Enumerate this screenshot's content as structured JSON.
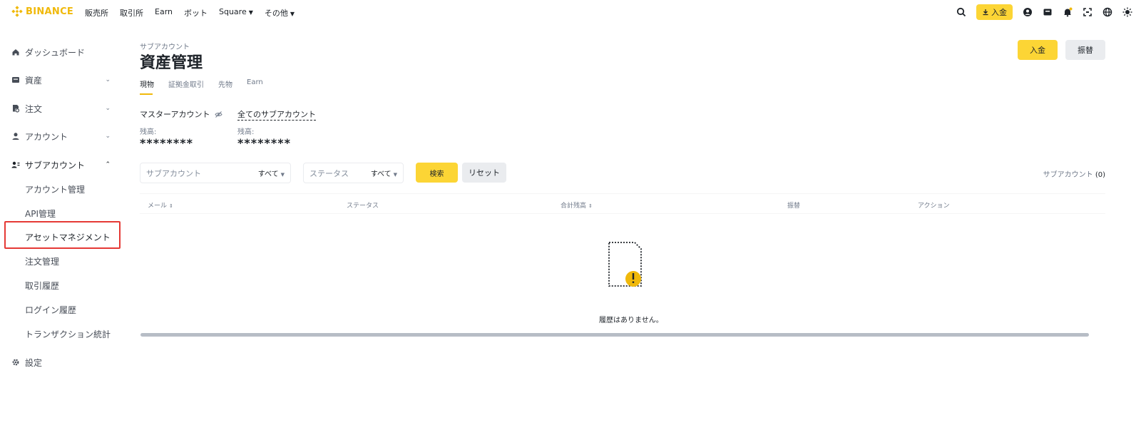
{
  "brand": {
    "name": "BINANCE",
    "color": "#f0b90b"
  },
  "nav": {
    "items": [
      {
        "label": "販売所"
      },
      {
        "label": "取引所"
      },
      {
        "label": "Earn"
      },
      {
        "label": "ボット"
      },
      {
        "label": "Square",
        "has_caret": true
      },
      {
        "label": "その他",
        "has_caret": true
      }
    ],
    "deposit_label": "入金",
    "icons": [
      "search-icon",
      "download-icon",
      "user-icon",
      "wallet-icon",
      "bell-icon",
      "qr-scan-icon",
      "globe-icon",
      "theme-icon"
    ]
  },
  "sidebar": {
    "items": [
      {
        "label": "ダッシュボード",
        "icon": "home-icon"
      },
      {
        "label": "資産",
        "icon": "wallet-icon",
        "chevron": "down"
      },
      {
        "label": "注文",
        "icon": "orders-icon",
        "chevron": "down"
      },
      {
        "label": "アカウント",
        "icon": "account-icon",
        "chevron": "down"
      },
      {
        "label": "サブアカウント",
        "icon": "sub-account-icon",
        "chevron": "up"
      },
      {
        "label": "設定",
        "icon": "gear-icon"
      }
    ],
    "sub_items": [
      {
        "label": "アカウント管理"
      },
      {
        "label": "API管理"
      },
      {
        "label": "アセットマネジメント"
      },
      {
        "label": "注文管理"
      },
      {
        "label": "取引履歴"
      },
      {
        "label": "ログイン履歴"
      },
      {
        "label": "トランザクション統計"
      }
    ],
    "highlight_color": "#e53935"
  },
  "main": {
    "breadcrumb": "サブアカウント",
    "title": "資産管理",
    "deposit_label": "入金",
    "transfer_label": "振替",
    "tabs": [
      {
        "label": "現物",
        "active": true
      },
      {
        "label": "証拠金取引"
      },
      {
        "label": "先物"
      },
      {
        "label": "Earn"
      }
    ],
    "master_account": {
      "label": "マスターアカウント",
      "balance_label": "残高:",
      "balance_value": "********"
    },
    "all_sub_accounts": {
      "label": "全てのサブアカウント",
      "balance_label": "残高:",
      "balance_value": "********"
    },
    "filters": {
      "sub_account_placeholder": "サブアカウント",
      "sub_account_value": "すべて",
      "status_placeholder": "ステータス",
      "status_value": "すべて",
      "search_label": "検索",
      "reset_label": "リセット",
      "count_label": "サブアカウント",
      "count_value": "(0)"
    },
    "table": {
      "columns": [
        {
          "label": "メール",
          "sortable": true
        },
        {
          "label": "ステータス"
        },
        {
          "label": "合計残高",
          "sortable": true
        },
        {
          "label": "振替"
        },
        {
          "label": "アクション"
        }
      ],
      "empty_text": "履歴はありません。"
    }
  },
  "colors": {
    "accent": "#fcd535",
    "text": "#1e2329",
    "muted": "#707a8a",
    "button_gray": "#eaecef"
  }
}
